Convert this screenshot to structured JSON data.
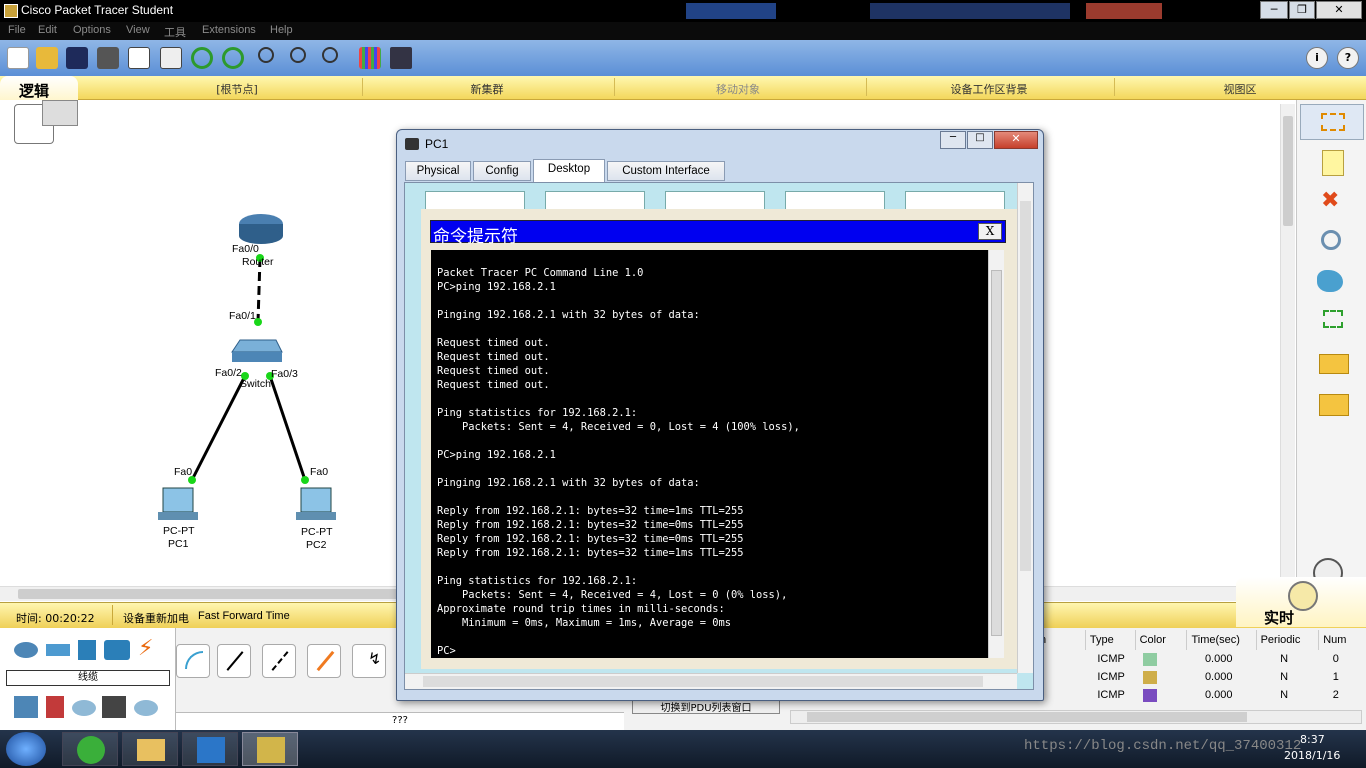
{
  "app_title": "Cisco Packet Tracer Student",
  "menu": [
    "File",
    "Edit",
    "Options",
    "View",
    "工具",
    "Extensions",
    "Help"
  ],
  "tabbar": {
    "logical": "逻辑",
    "root": "[根节点]",
    "cluster": "新集群",
    "move": "移动对象",
    "bg": "设备工作区背景",
    "viewport": "视图区"
  },
  "devices": {
    "router": {
      "name": "Router",
      "port": "Fa0/0"
    },
    "switch": {
      "name": "Switch",
      "port_up": "Fa0/1",
      "port_left": "Fa0/2",
      "port_right": "Fa0/3"
    },
    "pc1": {
      "type": "PC-PT",
      "name": "PC1",
      "port": "Fa0"
    },
    "pc2": {
      "type": "PC-PT",
      "name": "PC2",
      "port": "Fa0"
    }
  },
  "status": {
    "time": "时间: 00:20:22",
    "power": "设备重新加电",
    "fft": "Fast Forward Time",
    "realtime": "实时"
  },
  "device_palette_label": "线缆",
  "device_hint": "???",
  "pdu_switch": "切换到PDU列表窗口",
  "events": {
    "headers": [
      "n",
      "Type",
      "Color",
      "Time(sec)",
      "Periodic",
      "Num"
    ],
    "rows": [
      {
        "type": "ICMP",
        "color": "#8fcca1",
        "time": "0.000",
        "periodic": "N",
        "num": "0"
      },
      {
        "type": "ICMP",
        "color": "#cfae4a",
        "time": "0.000",
        "periodic": "N",
        "num": "1"
      },
      {
        "type": "ICMP",
        "color": "#7a4cc0",
        "time": "0.000",
        "periodic": "N",
        "num": "2"
      }
    ]
  },
  "pc_window": {
    "title": "PC1",
    "tabs": [
      "Physical",
      "Config",
      "Desktop",
      "Custom Interface"
    ],
    "active_tab": "Desktop",
    "cmd_title": "命令提示符",
    "cmd_close": "X",
    "cmd_lines": [
      "Packet Tracer PC Command Line 1.0",
      "PC>ping 192.168.2.1",
      "",
      "Pinging 192.168.2.1 with 32 bytes of data:",
      "",
      "Request timed out.",
      "Request timed out.",
      "Request timed out.",
      "Request timed out.",
      "",
      "Ping statistics for 192.168.2.1:",
      "    Packets: Sent = 4, Received = 0, Lost = 4 (100% loss),",
      "",
      "PC>ping 192.168.2.1",
      "",
      "Pinging 192.168.2.1 with 32 bytes of data:",
      "",
      "Reply from 192.168.2.1: bytes=32 time=1ms TTL=255",
      "Reply from 192.168.2.1: bytes=32 time=0ms TTL=255",
      "Reply from 192.168.2.1: bytes=32 time=0ms TTL=255",
      "Reply from 192.168.2.1: bytes=32 time=1ms TTL=255",
      "",
      "Ping statistics for 192.168.2.1:",
      "    Packets: Sent = 4, Received = 4, Lost = 0 (0% loss),",
      "Approximate round trip times in milli-seconds:",
      "    Minimum = 0ms, Maximum = 1ms, Average = 0ms",
      "",
      "PC>"
    ]
  },
  "taskbar": {
    "time": "8:37",
    "date": "2018/1/16",
    "watermark": "https://blog.csdn.net/qq_37400312"
  },
  "colors": {
    "toolbar": "#6d9ee0",
    "yellow": "#f3d75c",
    "cmd_title": "#0000f0",
    "link_green": "#19d619"
  }
}
